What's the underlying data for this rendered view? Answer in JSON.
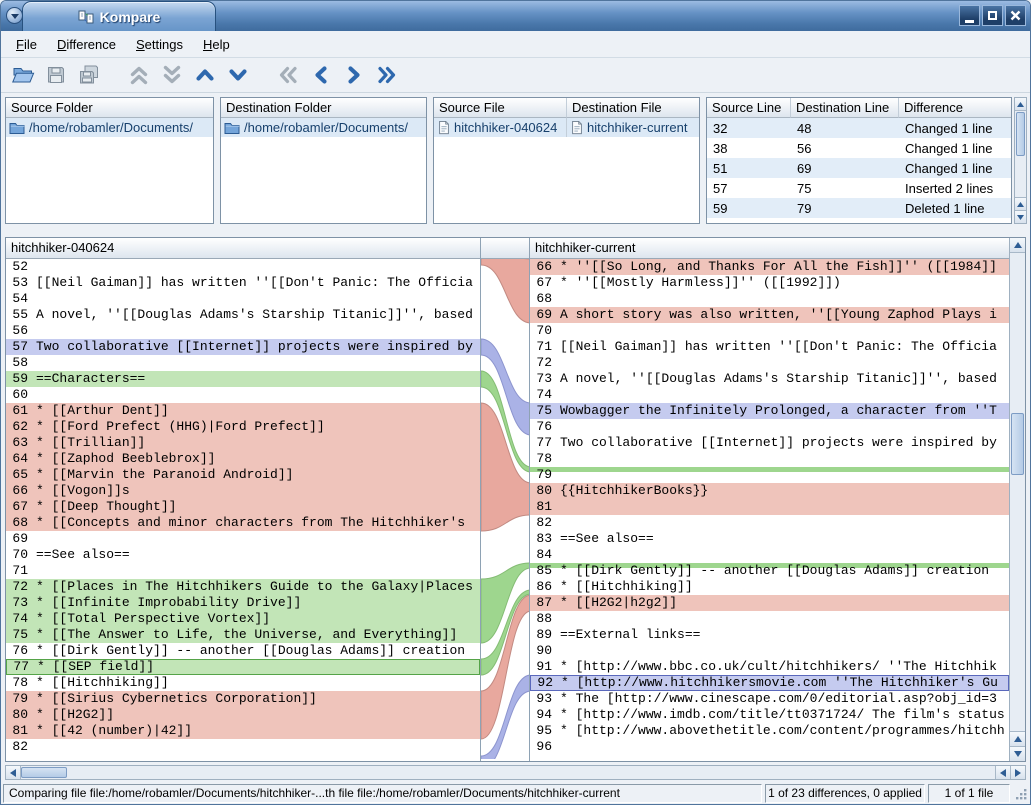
{
  "window": {
    "title": "Kompare"
  },
  "menu": {
    "items": [
      "File",
      "Difference",
      "Settings",
      "Help"
    ]
  },
  "toolbar": {
    "buttons": [
      {
        "name": "open",
        "icon": "folder-open-icon",
        "enabled": true
      },
      {
        "name": "save",
        "icon": "floppy-icon",
        "enabled": false
      },
      {
        "name": "save-all",
        "icon": "floppy-stack-icon",
        "enabled": false
      },
      {
        "name": "previous-file",
        "icon": "double-chevron-up-icon",
        "enabled": false
      },
      {
        "name": "next-file",
        "icon": "double-chevron-down-icon",
        "enabled": false
      },
      {
        "name": "previous-difference",
        "icon": "chevron-up-icon",
        "enabled": true
      },
      {
        "name": "next-difference",
        "icon": "chevron-down-icon",
        "enabled": true
      },
      {
        "name": "back-double",
        "icon": "double-chevron-left-icon",
        "enabled": false
      },
      {
        "name": "back",
        "icon": "chevron-left-icon",
        "enabled": true
      },
      {
        "name": "forward",
        "icon": "chevron-right-icon",
        "enabled": true
      },
      {
        "name": "forward-double",
        "icon": "double-chevron-right-icon",
        "enabled": true
      }
    ]
  },
  "icons": {
    "window-menu-icon": "▾",
    "minimize-icon": "▁",
    "maximize-icon": "□",
    "close-icon": "×",
    "folder-open-icon": "📂",
    "floppy-icon": "💾",
    "floppy-stack-icon": "💾💾",
    "chevron-up-icon": "⌃",
    "chevron-down-icon": "⌄",
    "chevron-left-icon": "‹",
    "chevron-right-icon": "›",
    "double-chevron-up-icon": "⌃⌃",
    "double-chevron-down-icon": "⌄⌄",
    "double-chevron-left-icon": "«",
    "double-chevron-right-icon": "»",
    "folder-icon": "🗀",
    "file-icon": "🗎",
    "resize-grip-icon": "◢"
  },
  "folders": {
    "source": {
      "header": "Source Folder",
      "path": "/home/robamler/Documents/"
    },
    "destination": {
      "header": "Destination Folder",
      "path": "/home/robamler/Documents/"
    }
  },
  "files": {
    "source_header": "Source File",
    "destination_header": "Destination File",
    "source": "hitchhiker-040624",
    "destination": "hitchhiker-current"
  },
  "differences": {
    "headers": [
      "Source Line",
      "Destination Line",
      "Difference"
    ],
    "rows": [
      [
        "32",
        "48",
        "Changed 1 line"
      ],
      [
        "38",
        "56",
        "Changed 1 line"
      ],
      [
        "51",
        "69",
        "Changed 1 line"
      ],
      [
        "57",
        "75",
        "Inserted 2 lines"
      ],
      [
        "59",
        "79",
        "Deleted 1 line"
      ]
    ]
  },
  "diff": {
    "left_title": "hitchhiker-040624",
    "right_title": "hitchhiker-current",
    "left_lines": [
      {
        "n": 52,
        "t": ""
      },
      {
        "n": 53,
        "t": "[[Neil Gaiman]] has written ''[[Don't Panic: The Officia"
      },
      {
        "n": 54,
        "t": ""
      },
      {
        "n": 55,
        "t": "A novel, ''[[Douglas Adams's Starship Titanic]]'', based"
      },
      {
        "n": 56,
        "t": ""
      },
      {
        "n": 57,
        "t": "Two collaborative [[Internet]] projects were inspired by",
        "c": "chg"
      },
      {
        "n": 58,
        "t": ""
      },
      {
        "n": 59,
        "t": "==Characters==",
        "c": "add"
      },
      {
        "n": 60,
        "t": ""
      },
      {
        "n": 61,
        "t": "* [[Arthur Dent]]",
        "c": "rem"
      },
      {
        "n": 62,
        "t": "* [[Ford Prefect (HHG)|Ford Prefect]]",
        "c": "rem"
      },
      {
        "n": 63,
        "t": "* [[Trillian]]",
        "c": "rem"
      },
      {
        "n": 64,
        "t": "* [[Zaphod Beeblebrox]]",
        "c": "rem"
      },
      {
        "n": 65,
        "t": "* [[Marvin the Paranoid Android]]",
        "c": "rem"
      },
      {
        "n": 66,
        "t": "* [[Vogon]]s",
        "c": "rem"
      },
      {
        "n": 67,
        "t": "* [[Deep Thought]]",
        "c": "rem"
      },
      {
        "n": 68,
        "t": "* [[Concepts and minor characters from The Hitchhiker's",
        "c": "rem"
      },
      {
        "n": 69,
        "t": ""
      },
      {
        "n": 70,
        "t": "==See also=="
      },
      {
        "n": 71,
        "t": ""
      },
      {
        "n": 72,
        "t": "* [[Places in The Hitchhikers Guide to the Galaxy|Places",
        "c": "add"
      },
      {
        "n": 73,
        "t": "* [[Infinite Improbability Drive]]",
        "c": "add"
      },
      {
        "n": 74,
        "t": "* [[Total Perspective Vortex]]",
        "c": "add"
      },
      {
        "n": 75,
        "t": "* [[The Answer to Life, the Universe, and Everything]]",
        "c": "add"
      },
      {
        "n": 76,
        "t": "* [[Dirk Gently]] -- another [[Douglas Adams]] creation"
      },
      {
        "n": 77,
        "t": "* [[SEP field]]",
        "c": "add",
        "b": true
      },
      {
        "n": 78,
        "t": "* [[Hitchhiking]]"
      },
      {
        "n": 79,
        "t": "* [[Sirius Cybernetics Corporation]]",
        "c": "rem"
      },
      {
        "n": 80,
        "t": "* [[H2G2]]",
        "c": "rem"
      },
      {
        "n": 81,
        "t": "* [[42 (number)|42]]",
        "c": "rem"
      },
      {
        "n": 82,
        "t": ""
      }
    ],
    "right_lines": [
      {
        "n": 66,
        "t": "* ''[[So Long, and Thanks For All the Fish]]'' ([[1984]]",
        "c": "rem"
      },
      {
        "n": 67,
        "t": "* ''[[Mostly Harmless]]'' ([[1992]])"
      },
      {
        "n": 68,
        "t": ""
      },
      {
        "n": 69,
        "t": "A short story was also written, ''[[Young Zaphod Plays i",
        "c": "rem"
      },
      {
        "n": 70,
        "t": ""
      },
      {
        "n": 71,
        "t": "[[Neil Gaiman]] has written ''[[Don't Panic: The Officia"
      },
      {
        "n": 72,
        "t": ""
      },
      {
        "n": 73,
        "t": "A novel, ''[[Douglas Adams's Starship Titanic]]'', based"
      },
      {
        "n": 74,
        "t": ""
      },
      {
        "n": 75,
        "t": "Wowbagger the Infinitely Prolonged, a character from ''T",
        "c": "chg"
      },
      {
        "n": 76,
        "t": ""
      },
      {
        "n": 77,
        "t": "Two collaborative [[Internet]] projects were inspired by"
      },
      {
        "n": 78,
        "t": ""
      },
      {
        "n": 79,
        "t": "",
        "c": "addthin"
      },
      {
        "n": 80,
        "t": "{{HitchhikerBooks}}",
        "c": "rem"
      },
      {
        "n": 81,
        "t": "",
        "c": "rem"
      },
      {
        "n": 82,
        "t": ""
      },
      {
        "n": 83,
        "t": "==See also=="
      },
      {
        "n": 84,
        "t": ""
      },
      {
        "n": 85,
        "t": "* [[Dirk Gently]] -- another [[Douglas Adams]] creation",
        "c": "addthin"
      },
      {
        "n": 86,
        "t": "* [[Hitchhiking]]"
      },
      {
        "n": 87,
        "t": "* [[H2G2|h2g2]]",
        "c": "rem"
      },
      {
        "n": 88,
        "t": ""
      },
      {
        "n": 89,
        "t": "==External links=="
      },
      {
        "n": 90,
        "t": ""
      },
      {
        "n": 91,
        "t": "* [http://www.bbc.co.uk/cult/hitchhikers/ ''The Hitchhik"
      },
      {
        "n": 92,
        "t": "* [http://www.hitchhikersmovie.com ''The Hitchhiker's Gu",
        "c": "chg",
        "b": true
      },
      {
        "n": 93,
        "t": "* The [http://www.cinescape.com/0/editorial.asp?obj_id=3"
      },
      {
        "n": 94,
        "t": "* [http://www.imdb.com/title/tt0371724/ The film's status"
      },
      {
        "n": 95,
        "t": "* [http://www.abovethetitle.com/content/programmes/hitchh"
      },
      {
        "n": 96,
        "t": ""
      }
    ]
  },
  "statusbar": {
    "message": "Comparing file file:/home/robamler/Documents/hitchhiker-...th file file:/home/robamler/Documents/hitchhiker-current",
    "differences": "1 of 23 differences, 0 applied",
    "files": "1 of 1 file"
  },
  "colors": {
    "removed_bg": "#efc4bb",
    "added_bg": "#c2e5b7",
    "changed_bg": "#c5cbef",
    "removed_band": "#e8a89e",
    "added_band": "#9ed68e",
    "changed_band": "#aab2e6",
    "highlight_row": "#dce9f6",
    "link_text": "#17406c",
    "titlebar": "#4f7fb6"
  }
}
